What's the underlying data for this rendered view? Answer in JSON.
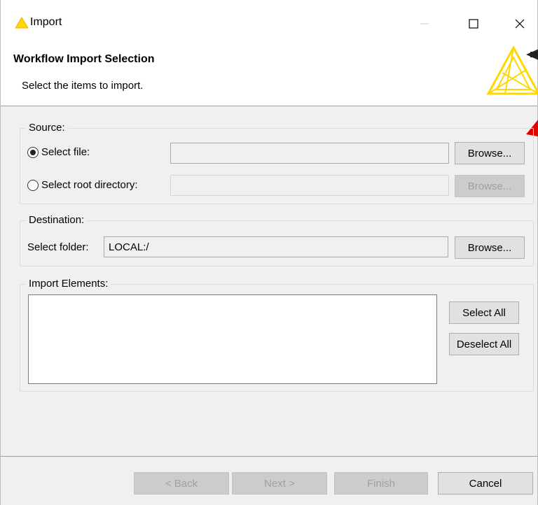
{
  "window": {
    "title": "Import",
    "icon": "knime-triangle-icon",
    "controls": [
      "minimize",
      "maximize",
      "close"
    ]
  },
  "banner": {
    "title": "Workflow Import Selection",
    "subtitle": "Select the items to import."
  },
  "source": {
    "group_label": "Source:",
    "select_file_label": "Select file:",
    "select_file_checked": true,
    "select_file_value": "",
    "select_root_label": "Select root directory:",
    "select_root_checked": false,
    "select_root_value": "",
    "browse_label": "Browse...",
    "browse_root_label": "Browse..."
  },
  "destination": {
    "group_label": "Destination:",
    "folder_label": "Select folder:",
    "folder_value": "LOCAL:/",
    "browse_label": "Browse..."
  },
  "import_elements": {
    "group_label": "Import Elements:",
    "items": [],
    "select_all_label": "Select All",
    "deselect_all_label": "Deselect All"
  },
  "footer": {
    "back_label": "< Back",
    "next_label": "Next >",
    "finish_label": "Finish",
    "cancel_label": "Cancel"
  },
  "colors": {
    "brand_yellow": "#ffd800",
    "marker_red": "#e10000"
  }
}
